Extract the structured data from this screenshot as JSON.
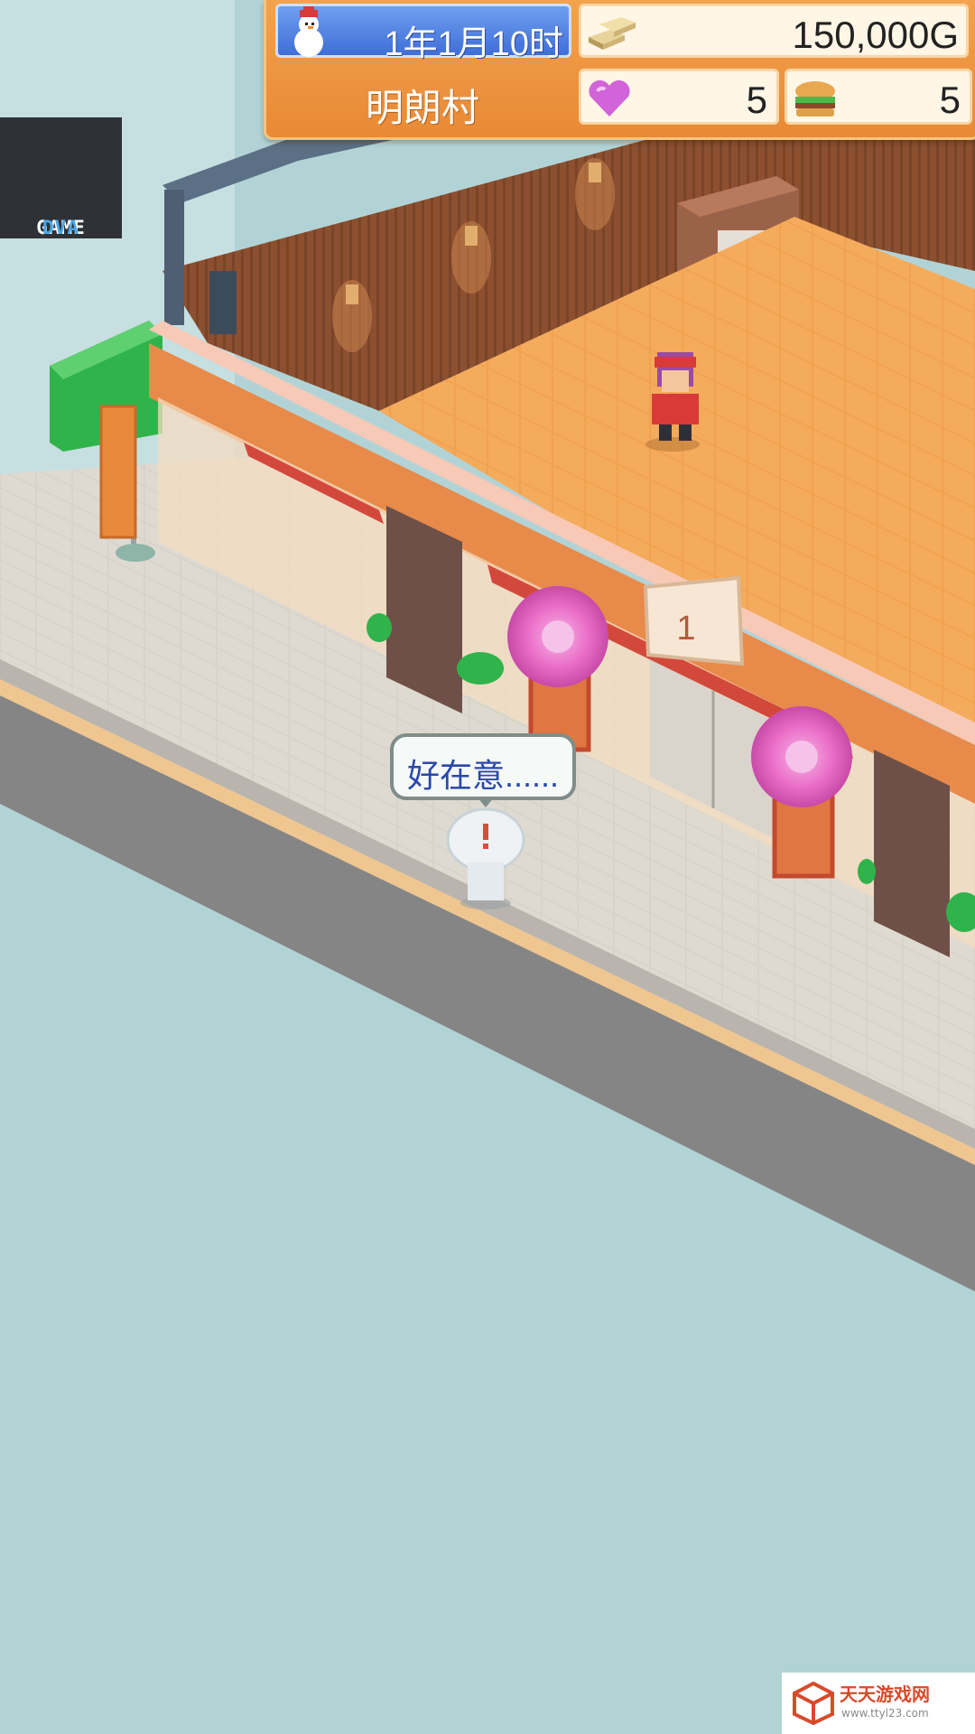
{
  "hud": {
    "date": "1年1月10时",
    "money": "150,000G",
    "village": "明朗村",
    "hearts": "5",
    "food": "5",
    "date_icon": "snowman-icon",
    "money_icon": "gold-bars-icon",
    "heart_icon": "heart-icon",
    "food_icon": "burger-icon"
  },
  "scene": {
    "speech_bubble": "好在意......",
    "sign_number": "1",
    "colors": {
      "sky": "#b2d3d6",
      "floor": "#f2a150",
      "wall": "#8c5030",
      "sidewalk": "#d8d3ca",
      "hud_orange": "#ef9440",
      "hud_blue": "#4f7fe0"
    }
  },
  "watermarks": {
    "top_left_a": "GAME",
    "top_left_b": "DVA",
    "bottom_right_title": "天天游戏网",
    "bottom_right_url": "www.ttyl23.com"
  }
}
